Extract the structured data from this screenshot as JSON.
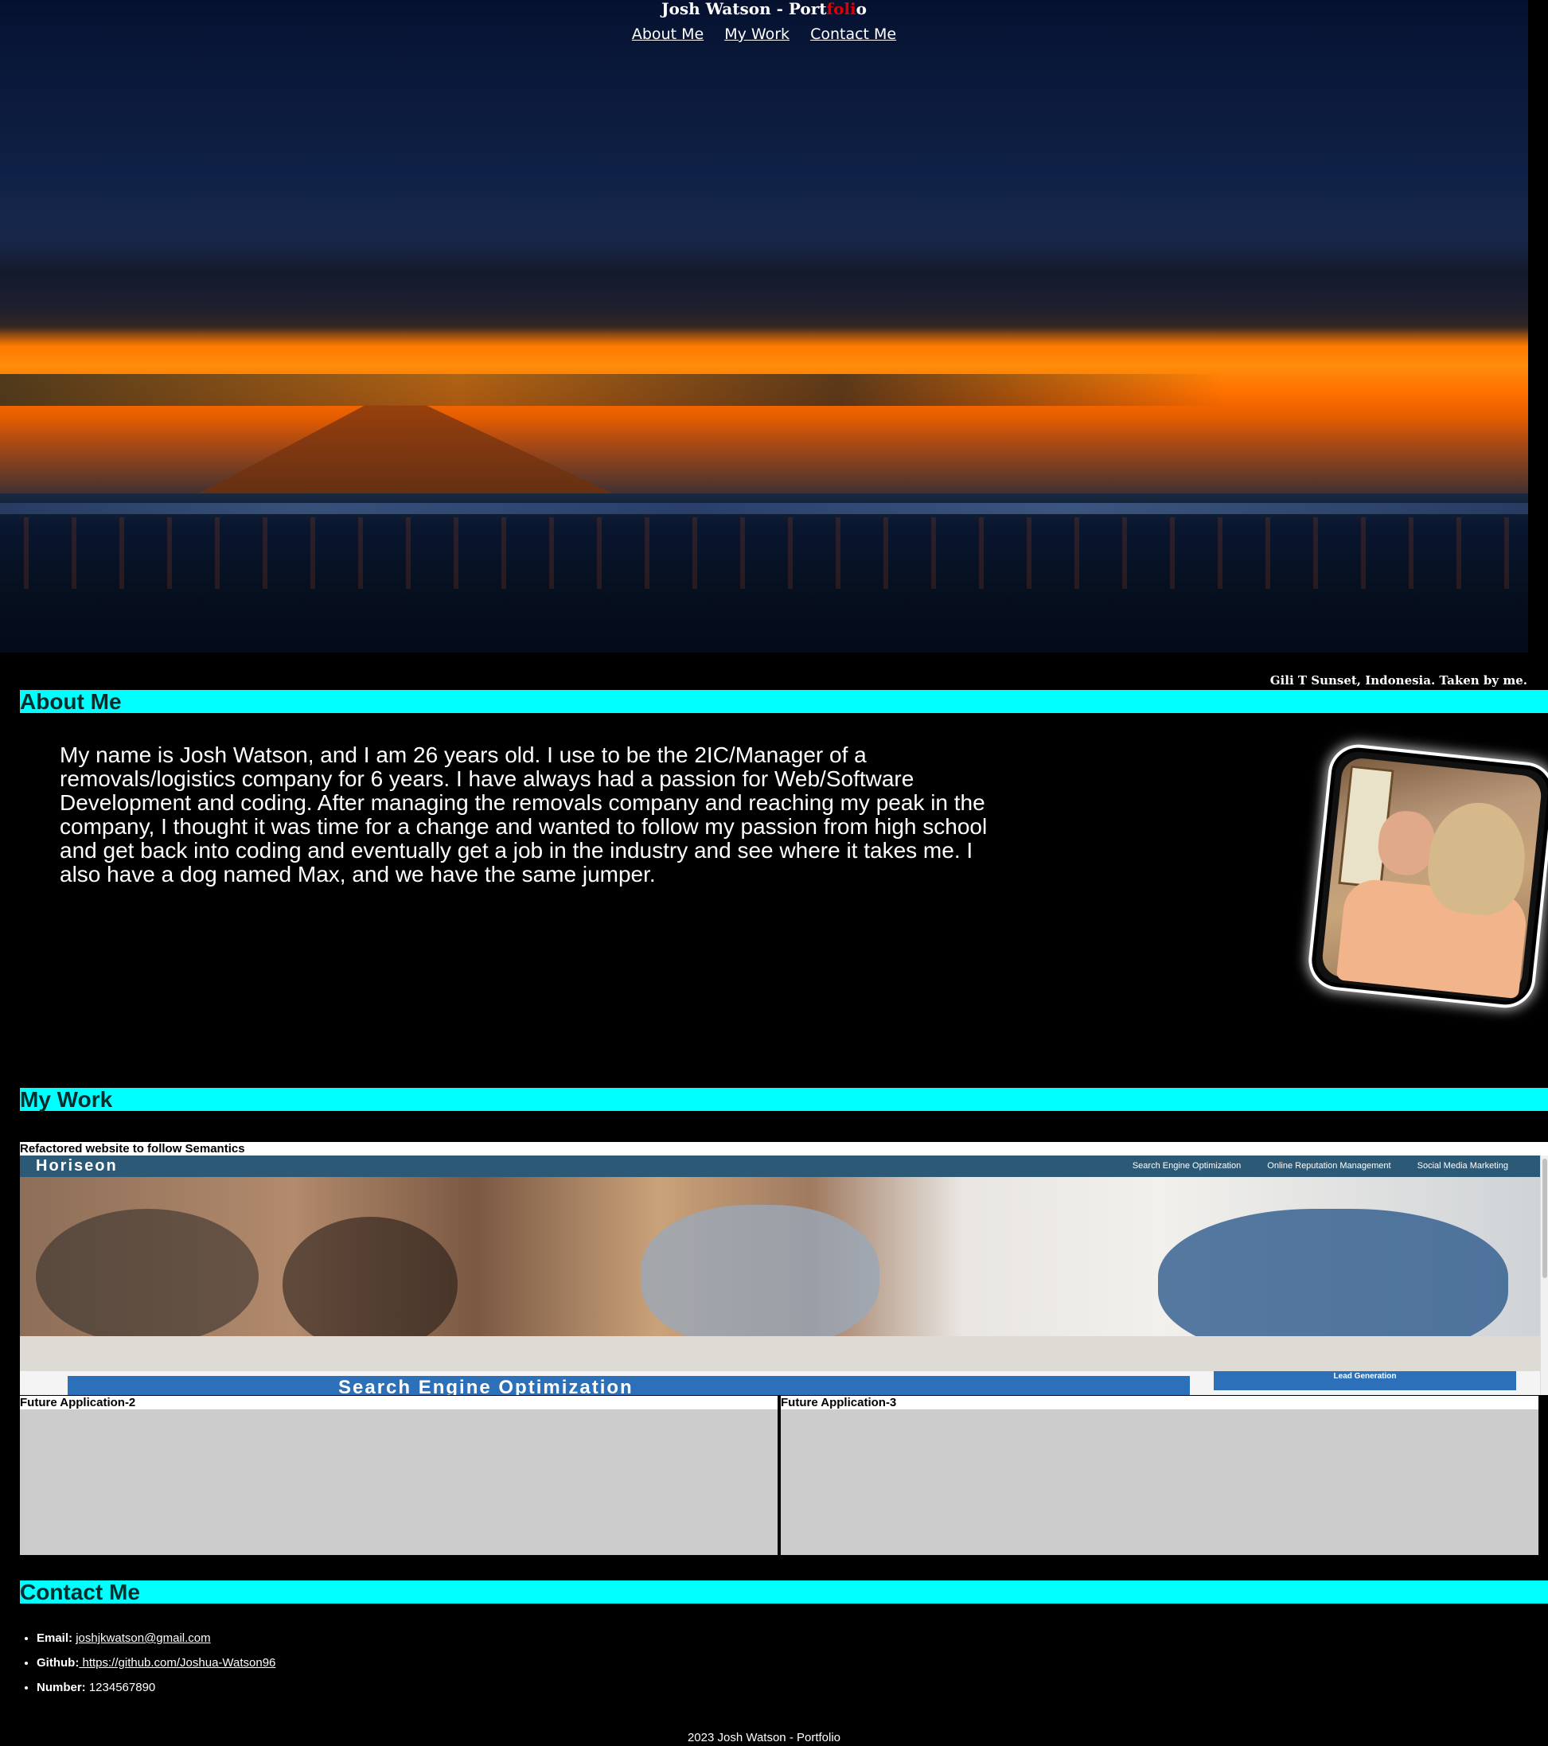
{
  "header": {
    "title_prefix": "Josh Watson - Port",
    "title_highlight": "foli",
    "title_suffix": "o",
    "nav": [
      "About Me",
      "My Work",
      "Contact Me"
    ],
    "hero_caption": "Gili T Sunset, Indonesia. Taken by me."
  },
  "about": {
    "heading": "About Me",
    "text": "My name is Josh Watson, and I am 26 years old. I use to be the 2IC/Manager of a removals/logistics company for 6 years. I have always had a passion for Web/Software Development and coding. After managing the removals company and reaching my peak in the company, I thought it was time for a change and wanted to follow my passion from high school and get back into coding and eventually get a job in the industry and see where it takes me. I also have a dog named Max, and we have the same jumper."
  },
  "work": {
    "heading": "My Work",
    "featured": {
      "label": "Refactored website to follow Semantics",
      "preview": {
        "logo": "Horiseon",
        "nav": [
          "Search Engine Optimization",
          "Online Reputation Management",
          "Social Media Marketing"
        ],
        "banner": "Search Engine Optimization",
        "sidebar": "Lead Generation"
      }
    },
    "future": [
      "Future Application-2",
      "Future Application-3"
    ]
  },
  "contact": {
    "heading": "Contact Me",
    "items": [
      {
        "label": "Email:",
        "value": "joshjkwatson@gmail.com"
      },
      {
        "label": "Github:",
        "value": " https://github.com/Joshua-Watson96"
      },
      {
        "label": "Number:",
        "value": "1234567890"
      }
    ]
  },
  "footer": {
    "text": "2023 Josh Watson - Portfolio"
  },
  "colors": {
    "section_bar": "#00ffff",
    "title_highlight": "#e00000",
    "background": "#000000"
  }
}
